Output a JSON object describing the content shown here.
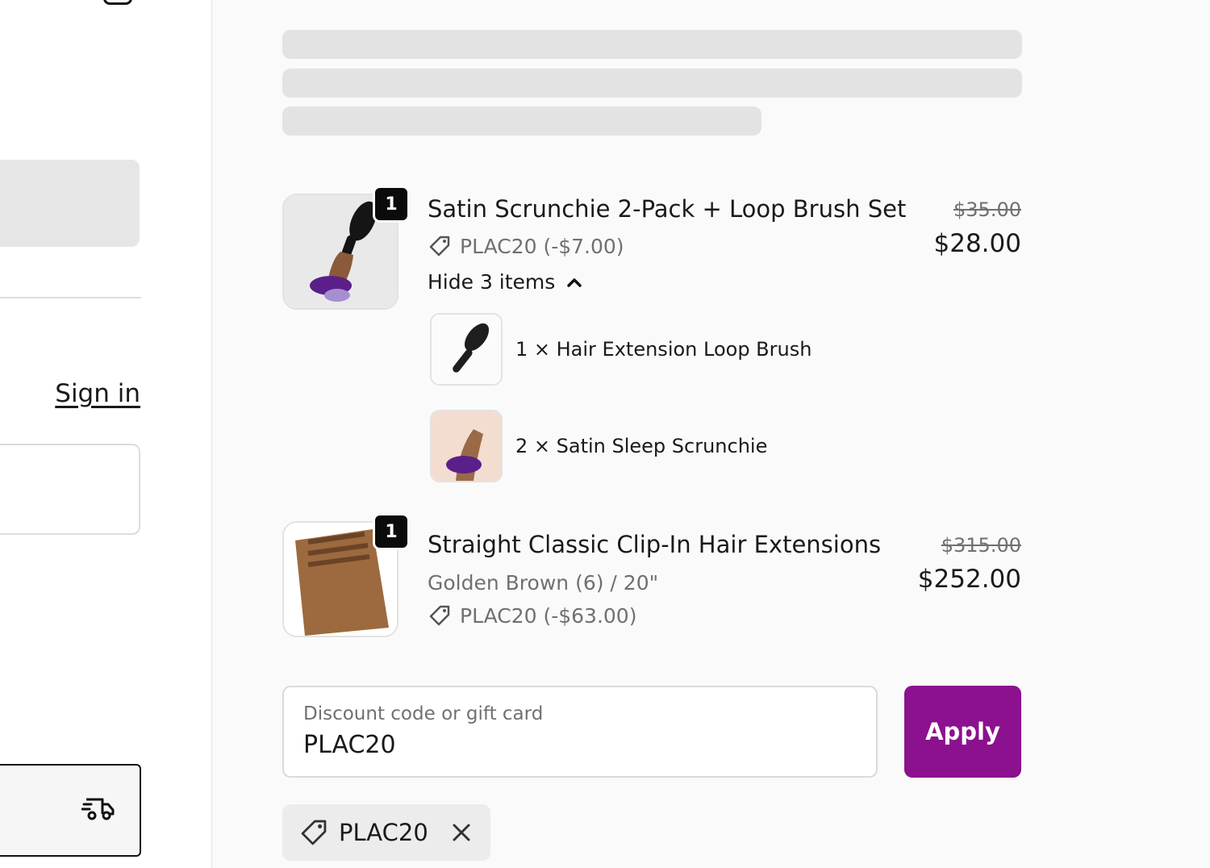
{
  "left": {
    "sign_in_label": "Sign in"
  },
  "summary": {
    "items": [
      {
        "quantity": "1",
        "title": "Satin Scrunchie 2-Pack + Loop Brush Set",
        "discount_code": "PLAC20 (-$7.00)",
        "price_original": "$35.00",
        "price_final": "$28.00",
        "toggle_label": "Hide 3 items",
        "bundle": [
          {
            "label": "1 × Hair Extension Loop Brush",
            "icon": "brush-image"
          },
          {
            "label": "2 × Satin Sleep Scrunchie",
            "icon": "scrunchie-image"
          }
        ]
      },
      {
        "quantity": "1",
        "title": "Straight Classic Clip-In Hair Extensions",
        "variant": "Golden Brown (6) / 20\"",
        "discount_code": "PLAC20 (-$63.00)",
        "price_original": "$315.00",
        "price_final": "$252.00"
      }
    ],
    "discount": {
      "placeholder": "Discount code or gift card",
      "value": "PLAC20",
      "apply_label": "Apply",
      "applied_code": "PLAC20"
    },
    "colors": {
      "accent": "#8b118f",
      "badge": "#0b0b0b"
    }
  }
}
